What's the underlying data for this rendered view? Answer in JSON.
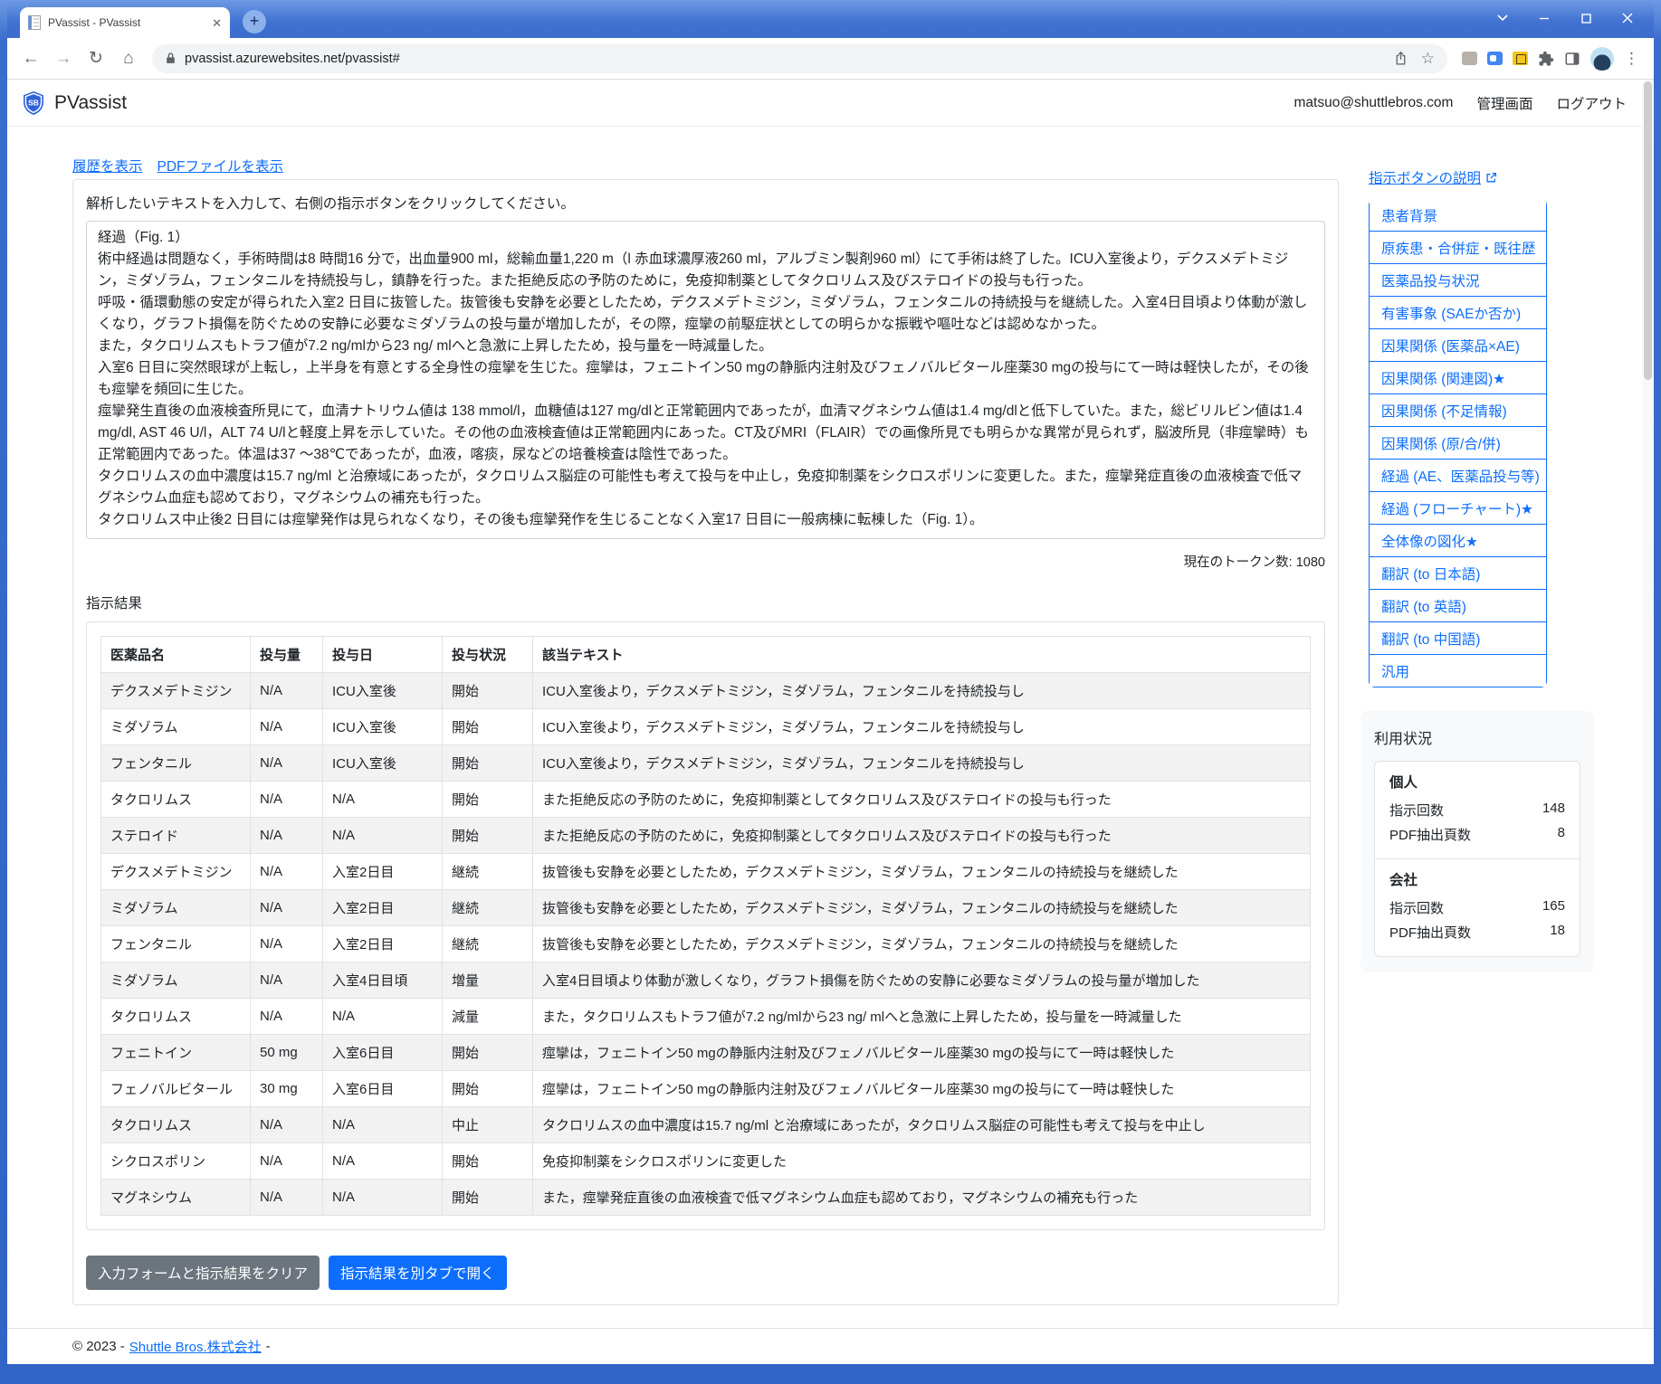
{
  "browser": {
    "tab_title": "PVassist - PVassist",
    "url": "pvassist.azurewebsites.net/pvassist#"
  },
  "header": {
    "app_name": "PVassist",
    "logo_initials": "SB",
    "user_email": "matsuo@shuttlebros.com",
    "admin_label": "管理画面",
    "logout_label": "ログアウト"
  },
  "main": {
    "history_link": "履歴を表示",
    "pdf_link": "PDFファイルを表示",
    "instruction": "解析したいテキストを入力して、右側の指示ボタンをクリックしてください。",
    "input_text": "経過（Fig. 1）\n術中経過は問題なく，手術時間は8 時間16 分で，出血量900 ml，総輸血量1,220 m（l 赤血球濃厚液260 ml，アルブミン製剤960 ml）にて手術は終了した。ICU入室後より，デクスメデトミジン，ミダゾラム，フェンタニルを持続投与し，鎮静を行った。また拒絶反応の予防のために，免疫抑制薬としてタクロリムス及びステロイドの投与も行った。\n呼吸・循環動態の安定が得られた入室2 日目に抜管した。抜管後も安静を必要としたため，デクスメデトミジン，ミダゾラム，フェンタニルの持続投与を継続した。入室4日目頃より体動が激しくなり，グラフト損傷を防ぐための安静に必要なミダゾラムの投与量が増加したが，その際，痙攣の前駆症状としての明らかな振戦や嘔吐などは認めなかった。\nまた，タクロリムスもトラフ値が7.2 ng/mlから23 ng/ mlへと急激に上昇したため，投与量を一時減量した。\n入室6 日目に突然眼球が上転し，上半身を有意とする全身性の痙攣を生じた。痙攣は，フェニトイン50 mgの静脈内注射及びフェノバルビタール座薬30 mgの投与にて一時は軽快したが，その後も痙攣を頻回に生じた。\n痙攣発生直後の血液検査所見にて，血清ナトリウム値は 138 mmol/l，血糖値は127 mg/dlと正常範囲内であったが，血清マグネシウム値は1.4 mg/dlと低下していた。また，総ビリルビン値は1.4 mg/dl, AST 46 U/l，ALT 74 U/lと軽度上昇を示していた。その他の血液検査値は正常範囲内にあった。CT及びMRI（FLAIR）での画像所見でも明らかな異常が見られず，脳波所見（非痙攣時）も正常範囲内であった。体温は37 ～38℃であったが，血液，喀痰，尿などの培養検査は陰性であった。\nタクロリムスの血中濃度は15.7 ng/ml と治療域にあったが，タクロリムス脳症の可能性も考えて投与を中止し，免疫抑制薬をシクロスポリンに変更した。また，痙攣発症直後の血液検査で低マグネシウム血症も認めており，マグネシウムの補充も行った。\nタクロリムス中止後2 日目には痙攣発作は見られなくなり，その後も痙攣発作を生じることなく入室17 日目に一般病棟に転棟した（Fig. 1）。",
    "token_label": "現在のトークン数: 1080",
    "results_label": "指示結果",
    "table": {
      "headers": [
        "医薬品名",
        "投与量",
        "投与日",
        "投与状況",
        "該当テキスト"
      ],
      "rows": [
        [
          "デクスメデトミジン",
          "N/A",
          "ICU入室後",
          "開始",
          "ICU入室後より，デクスメデトミジン，ミダゾラム，フェンタニルを持続投与し"
        ],
        [
          "ミダゾラム",
          "N/A",
          "ICU入室後",
          "開始",
          "ICU入室後より，デクスメデトミジン，ミダゾラム，フェンタニルを持続投与し"
        ],
        [
          "フェンタニル",
          "N/A",
          "ICU入室後",
          "開始",
          "ICU入室後より，デクスメデトミジン，ミダゾラム，フェンタニルを持続投与し"
        ],
        [
          "タクロリムス",
          "N/A",
          "N/A",
          "開始",
          "また拒絶反応の予防のために，免疫抑制薬としてタクロリムス及びステロイドの投与も行った"
        ],
        [
          "ステロイド",
          "N/A",
          "N/A",
          "開始",
          "また拒絶反応の予防のために，免疫抑制薬としてタクロリムス及びステロイドの投与も行った"
        ],
        [
          "デクスメデトミジン",
          "N/A",
          "入室2日目",
          "継続",
          "抜管後も安静を必要としたため，デクスメデトミジン，ミダゾラム，フェンタニルの持続投与を継続した"
        ],
        [
          "ミダゾラム",
          "N/A",
          "入室2日目",
          "継続",
          "抜管後も安静を必要としたため，デクスメデトミジン，ミダゾラム，フェンタニルの持続投与を継続した"
        ],
        [
          "フェンタニル",
          "N/A",
          "入室2日目",
          "継続",
          "抜管後も安静を必要としたため，デクスメデトミジン，ミダゾラム，フェンタニルの持続投与を継続した"
        ],
        [
          "ミダゾラム",
          "N/A",
          "入室4日目頃",
          "増量",
          "入室4日目頃より体動が激しくなり，グラフト損傷を防ぐための安静に必要なミダゾラムの投与量が増加した"
        ],
        [
          "タクロリムス",
          "N/A",
          "N/A",
          "減量",
          "また，タクロリムスもトラフ値が7.2 ng/mlから23 ng/ mlへと急激に上昇したため，投与量を一時減量した"
        ],
        [
          "フェニトイン",
          "50 mg",
          "入室6日目",
          "開始",
          "痙攣は，フェニトイン50 mgの静脈内注射及びフェノバルビタール座薬30 mgの投与にて一時は軽快した"
        ],
        [
          "フェノバルビタール",
          "30 mg",
          "入室6日目",
          "開始",
          "痙攣は，フェニトイン50 mgの静脈内注射及びフェノバルビタール座薬30 mgの投与にて一時は軽快した"
        ],
        [
          "タクロリムス",
          "N/A",
          "N/A",
          "中止",
          "タクロリムスの血中濃度は15.7 ng/ml と治療域にあったが，タクロリムス脳症の可能性も考えて投与を中止し"
        ],
        [
          "シクロスポリン",
          "N/A",
          "N/A",
          "開始",
          "免疫抑制薬をシクロスポリンに変更した"
        ],
        [
          "マグネシウム",
          "N/A",
          "N/A",
          "開始",
          "また，痙攣発症直後の血液検査で低マグネシウム血症も認めており，マグネシウムの補充も行った"
        ]
      ]
    },
    "clear_button": "入力フォームと指示結果をクリア",
    "open_button": "指示結果を別タブで開く"
  },
  "sidebar": {
    "help_link": "指示ボタンの説明",
    "buttons": [
      "患者背景",
      "原疾患・合併症・既往歴",
      "医薬品投与状況",
      "有害事象 (SAEか否か)",
      "因果関係 (医薬品×AE)",
      "因果関係 (関連図)★",
      "因果関係 (不足情報)",
      "因果関係 (原/合/併)",
      "経過 (AE、医薬品投与等)",
      "経過 (フローチャート)★",
      "全体像の図化★",
      "翻訳 (to 日本語)",
      "翻訳 (to 英語)",
      "翻訳 (to 中国語)",
      "汎用"
    ],
    "usage": {
      "title": "利用状況",
      "personal": {
        "name": "個人",
        "rows": [
          {
            "label": "指示回数",
            "value": "148"
          },
          {
            "label": "PDF抽出頁数",
            "value": "8"
          }
        ]
      },
      "company": {
        "name": "会社",
        "rows": [
          {
            "label": "指示回数",
            "value": "165"
          },
          {
            "label": "PDF抽出頁数",
            "value": "18"
          }
        ]
      }
    }
  },
  "footer": {
    "copyright": "© 2023 -",
    "company": "Shuttle Bros.株式会社",
    "suffix": "-"
  },
  "colors": {
    "accent": "#0d6efd",
    "secondary": "#6c757d",
    "titlebar": "#3a6ccc",
    "table_stripe": "#f2f2f2"
  }
}
